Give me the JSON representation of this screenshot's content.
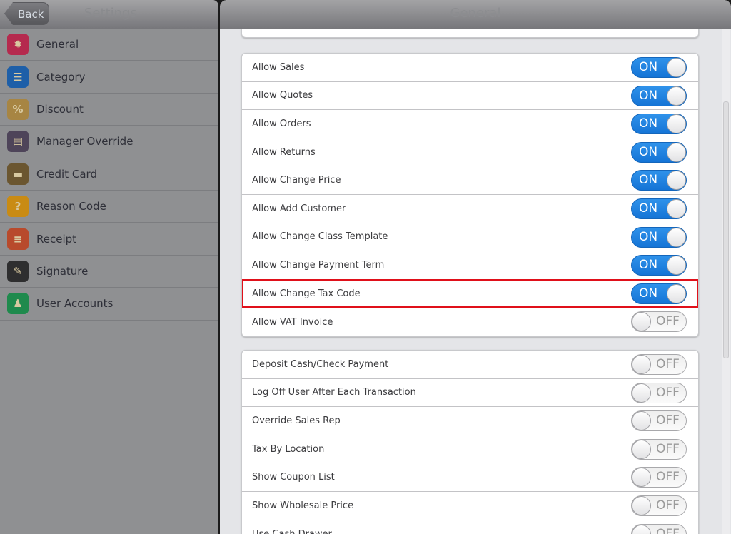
{
  "left": {
    "back_label": "Back",
    "title": "Settings",
    "items": [
      {
        "label": "General",
        "icon": "gear-icon",
        "color": "#b52a4e",
        "glyph": "✹"
      },
      {
        "label": "Category",
        "icon": "list-icon",
        "color": "#1e5fa8",
        "glyph": "☰"
      },
      {
        "label": "Discount",
        "icon": "tag-icon",
        "color": "#a78543",
        "glyph": "%"
      },
      {
        "label": "Manager Override",
        "icon": "id-card-icon",
        "color": "#4e4459",
        "glyph": "▤"
      },
      {
        "label": "Credit Card",
        "icon": "credit-card-icon",
        "color": "#6b5630",
        "glyph": "▬"
      },
      {
        "label": "Reason Code",
        "icon": "question-icon",
        "color": "#c98b14",
        "glyph": "?"
      },
      {
        "label": "Receipt",
        "icon": "receipt-icon",
        "color": "#b84a2c",
        "glyph": "≡"
      },
      {
        "label": "Signature",
        "icon": "pen-icon",
        "color": "#2e2e2f",
        "glyph": "✎"
      },
      {
        "label": "User Accounts",
        "icon": "user-icon",
        "color": "#1f8a4d",
        "glyph": "♟"
      }
    ]
  },
  "right": {
    "title": "General",
    "group1": [
      {
        "label": "Allow Sales",
        "state": "ON"
      },
      {
        "label": "Allow Quotes",
        "state": "ON"
      },
      {
        "label": "Allow Orders",
        "state": "ON"
      },
      {
        "label": "Allow Returns",
        "state": "ON"
      },
      {
        "label": "Allow Change Price",
        "state": "ON"
      },
      {
        "label": "Allow Add Customer",
        "state": "ON"
      },
      {
        "label": "Allow Change Class Template",
        "state": "ON"
      },
      {
        "label": "Allow Change Payment Term",
        "state": "ON"
      },
      {
        "label": "Allow Change Tax Code",
        "state": "ON",
        "highlight": true
      },
      {
        "label": "Allow VAT Invoice",
        "state": "OFF"
      }
    ],
    "group2": [
      {
        "label": "Deposit Cash/Check Payment",
        "state": "OFF"
      },
      {
        "label": "Log Off User After Each Transaction",
        "state": "OFF"
      },
      {
        "label": "Override Sales Rep",
        "state": "OFF"
      },
      {
        "label": "Tax By Location",
        "state": "OFF"
      },
      {
        "label": "Show Coupon List",
        "state": "OFF"
      },
      {
        "label": "Show Wholesale Price",
        "state": "OFF"
      },
      {
        "label": "Use Cash Drawer",
        "state": "OFF"
      }
    ]
  }
}
